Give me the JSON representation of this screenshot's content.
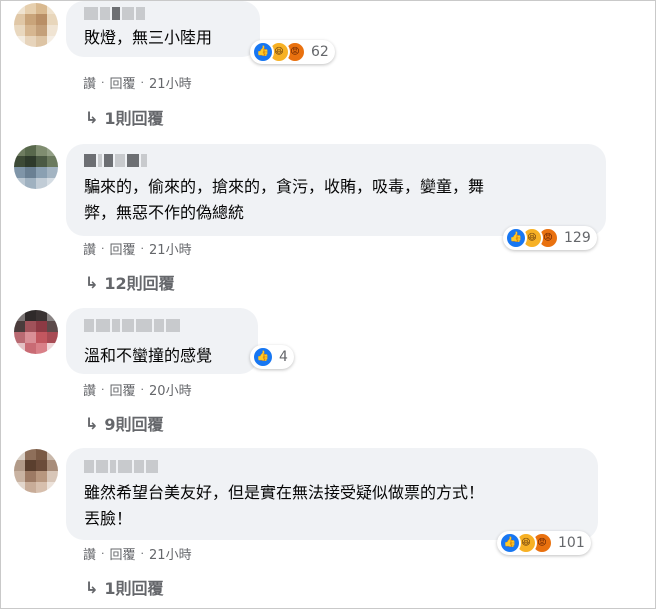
{
  "comments": [
    {
      "text_lines": [
        "敗燈，無三小陸用"
      ],
      "reaction_count": "62",
      "reaction_types": [
        "like-icon",
        "haha-icon",
        "angry-icon"
      ],
      "actions": {
        "like": "讚",
        "reply": "回覆",
        "time": "21小時"
      },
      "replies_label": "1則回覆"
    },
    {
      "text_lines": [
        "騙來的，偷來的，搶來的，貪污，收賄，吸毒，孌童，舞",
        "弊，無惡不作的偽總統"
      ],
      "reaction_count": "129",
      "reaction_types": [
        "like-icon",
        "haha-icon",
        "angry-icon"
      ],
      "actions": {
        "like": "讚",
        "reply": "回覆",
        "time": "21小時"
      },
      "replies_label": "12則回覆"
    },
    {
      "text_lines": [
        "溫和不蠻撞的感覺"
      ],
      "reaction_count": "4",
      "reaction_types": [
        "like-icon"
      ],
      "actions": {
        "like": "讚",
        "reply": "回覆",
        "time": "20小時"
      },
      "replies_label": "9則回覆"
    },
    {
      "text_lines": [
        "雖然希望台美友好，但是實在無法接受疑似做票的方式！",
        "丟臉！"
      ],
      "reaction_count": "101",
      "reaction_types": [
        "like-icon",
        "haha-icon",
        "angry-icon"
      ],
      "actions": {
        "like": "讚",
        "reply": "回覆",
        "time": "21小時"
      },
      "replies_label": "1則回覆"
    }
  ],
  "colors": {
    "bubble": "#f0f2f5",
    "meta_text": "#65676b",
    "like": "#1877f2",
    "haha": "#f7b125",
    "angry": "#e9710f"
  }
}
